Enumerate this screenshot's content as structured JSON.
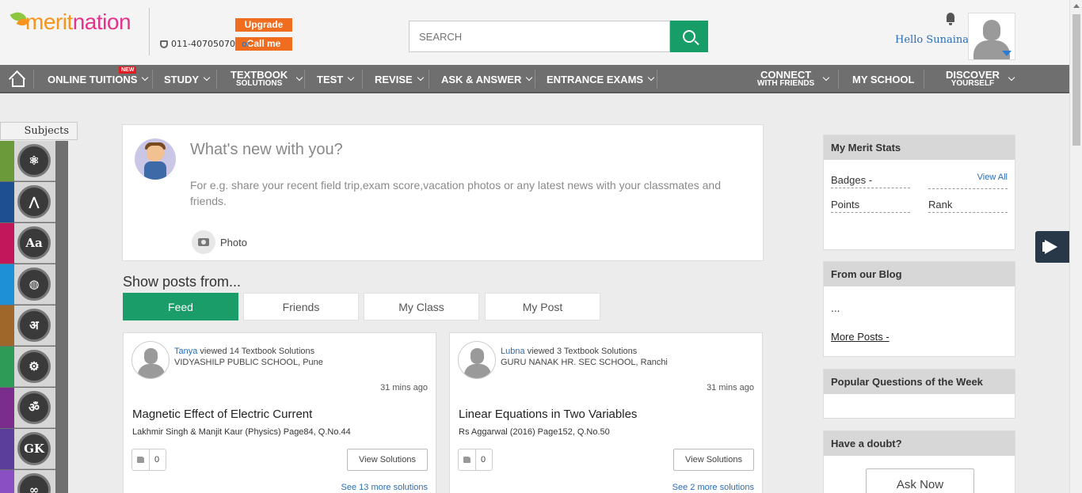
{
  "header": {
    "logo": {
      "part1": "merit",
      "part2": "nation"
    },
    "phone": "011-40705070",
    "or": "or",
    "upgrade_label": "Upgrade",
    "callme_label": "Call me",
    "search_placeholder": "SEARCH",
    "greeting": "Hello Sunaina"
  },
  "nav": {
    "items": [
      {
        "label": "ONLINE TUITIONS",
        "badge": "NEW"
      },
      {
        "label": "STUDY"
      },
      {
        "label": "TEXTBOOK",
        "sub": "SOLUTIONS"
      },
      {
        "label": "TEST"
      },
      {
        "label": "REVISE"
      },
      {
        "label": "ASK & ANSWER"
      },
      {
        "label": "ENTRANCE EXAMS"
      },
      {
        "label": "CONNECT",
        "sub": "WITH FRIENDS"
      },
      {
        "label": "MY SCHOOL"
      },
      {
        "label": "DISCOVER",
        "sub": "YOURSELF"
      }
    ]
  },
  "subjects": {
    "tab_label": "Subjects",
    "items": [
      {
        "icon": "atom-icon",
        "glyph": "⚛",
        "color": "#6a9a3a"
      },
      {
        "icon": "compass-icon",
        "glyph": "⋀",
        "color": "#1d4f91"
      },
      {
        "icon": "english-icon",
        "glyph": "Aa",
        "color": "#c2185b"
      },
      {
        "icon": "globe-icon",
        "glyph": "◍",
        "color": "#1e90d6"
      },
      {
        "icon": "hindi-icon",
        "glyph": "अ",
        "color": "#a0672b"
      },
      {
        "icon": "gears-icon",
        "glyph": "⚙",
        "color": "#2e9b57"
      },
      {
        "icon": "sanskrit-icon",
        "glyph": "ॐ",
        "color": "#7b2d8e"
      },
      {
        "icon": "gk-icon",
        "glyph": "GK",
        "color": "#5b3d9c"
      },
      {
        "icon": "more-subject-icon",
        "glyph": "∞",
        "color": "#8a4fc2"
      }
    ]
  },
  "composer": {
    "prompt": "What's new with you?",
    "hint": "For e.g. share your recent field trip,exam score,vacation photos or any latest news with your classmates and friends.",
    "photo_label": "Photo"
  },
  "feed": {
    "heading": "Show posts from...",
    "tabs": [
      {
        "label": "Feed",
        "active": true
      },
      {
        "label": "Friends"
      },
      {
        "label": "My Class"
      },
      {
        "label": "My Post"
      }
    ],
    "posts": [
      {
        "user": "Tanya",
        "action": " viewed 14 Textbook Solutions",
        "school": "VIDYASHILP PUBLIC SCHOOL, Pune",
        "time": "31 mins ago",
        "title": "Magnetic Effect of Electric Current",
        "subtitle": "Lakhmir Singh & Manjit Kaur (Physics) Page84, Q.No.44",
        "likes": "0",
        "view_label": "View Solutions",
        "more": "See 13 more solutions"
      },
      {
        "user": "Lubna",
        "action": " viewed 3 Textbook Solutions",
        "school": "GURU NANAK HR. SEC SCHOOL, Ranchi",
        "time": "31 mins ago",
        "title": "Linear Equations in Two Variables",
        "subtitle": "Rs Aggarwal (2016) Page152, Q.No.50",
        "likes": "0",
        "view_label": "View Solutions",
        "more": "See 2 more solutions"
      }
    ]
  },
  "sidebar": {
    "stats": {
      "title": "My Merit Stats",
      "badges": "Badges -",
      "view_all": "View All",
      "points": "Points",
      "rank": "Rank"
    },
    "blog": {
      "title": "From our Blog",
      "snippet": "...",
      "more": "More Posts -"
    },
    "popular": {
      "title": "Popular Questions of the Week"
    },
    "doubt": {
      "title": "Have a doubt?",
      "ask": "Ask Now"
    }
  }
}
